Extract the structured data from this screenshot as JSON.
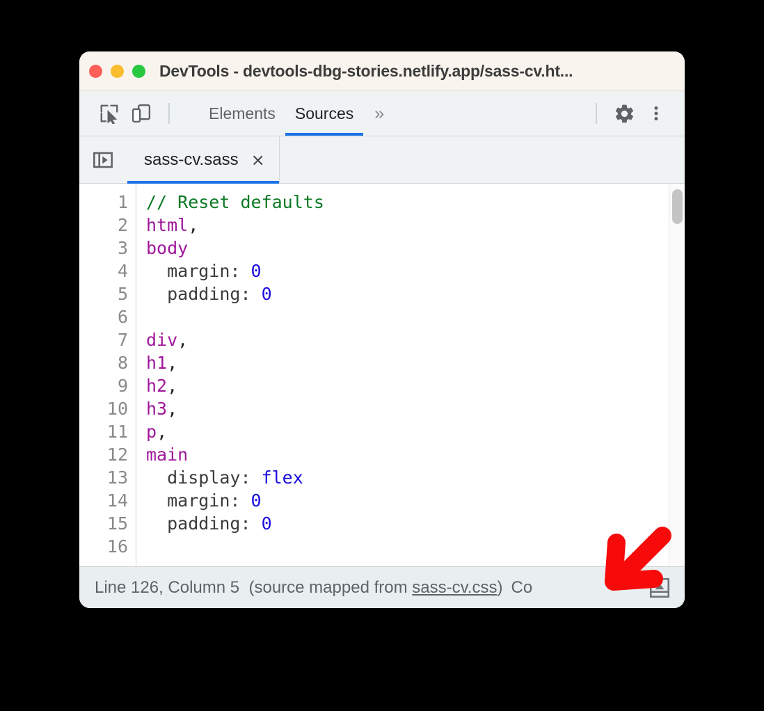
{
  "window": {
    "title": "DevTools - devtools-dbg-stories.netlify.app/sass-cv.ht...",
    "traffic_lights": [
      {
        "name": "close",
        "color": "#ff5f57"
      },
      {
        "name": "minimize",
        "color": "#f9bd2e"
      },
      {
        "name": "maximize",
        "color": "#28c840"
      }
    ]
  },
  "toolbar": {
    "inspect_icon": "inspect-element-icon",
    "device_icon": "device-toolbar-icon",
    "panels": [
      {
        "label": "Elements",
        "active": false
      },
      {
        "label": "Sources",
        "active": true
      }
    ],
    "more_panels_label": "»",
    "settings_icon": "gear-icon",
    "menu_icon": "kebab-menu-icon",
    "accent_color": "#1a73e8"
  },
  "file_tabs": {
    "navigator_toggle_icon": "show-navigator-icon",
    "tabs": [
      {
        "label": "sass-cv.sass",
        "close_label": "×",
        "active": true
      }
    ]
  },
  "editor": {
    "language": "sass",
    "first_visible_line": 1,
    "lines": [
      {
        "number": "1",
        "tokens": [
          {
            "t": "// Reset defaults",
            "c": "tok-comment"
          }
        ]
      },
      {
        "number": "2",
        "tokens": [
          {
            "t": "html",
            "c": "tok-selector"
          },
          {
            "t": ",",
            "c": "tok-punct"
          }
        ]
      },
      {
        "number": "3",
        "tokens": [
          {
            "t": "body",
            "c": "tok-selector"
          }
        ]
      },
      {
        "number": "4",
        "tokens": [
          {
            "t": "  margin: ",
            "c": "tok-prop"
          },
          {
            "t": "0",
            "c": "tok-value"
          }
        ]
      },
      {
        "number": "5",
        "tokens": [
          {
            "t": "  padding: ",
            "c": "tok-prop"
          },
          {
            "t": "0",
            "c": "tok-value"
          }
        ]
      },
      {
        "number": "6",
        "tokens": [
          {
            "t": "",
            "c": "tok-punct"
          }
        ]
      },
      {
        "number": "7",
        "tokens": [
          {
            "t": "div",
            "c": "tok-selector"
          },
          {
            "t": ",",
            "c": "tok-punct"
          }
        ]
      },
      {
        "number": "8",
        "tokens": [
          {
            "t": "h1",
            "c": "tok-selector"
          },
          {
            "t": ",",
            "c": "tok-punct"
          }
        ]
      },
      {
        "number": "9",
        "tokens": [
          {
            "t": "h2",
            "c": "tok-selector"
          },
          {
            "t": ",",
            "c": "tok-punct"
          }
        ]
      },
      {
        "number": "10",
        "tokens": [
          {
            "t": "h3",
            "c": "tok-selector"
          },
          {
            "t": ",",
            "c": "tok-punct"
          }
        ]
      },
      {
        "number": "11",
        "tokens": [
          {
            "t": "p",
            "c": "tok-selector"
          },
          {
            "t": ",",
            "c": "tok-punct"
          }
        ]
      },
      {
        "number": "12",
        "tokens": [
          {
            "t": "main",
            "c": "tok-selector"
          }
        ]
      },
      {
        "number": "13",
        "tokens": [
          {
            "t": "  display: ",
            "c": "tok-prop"
          },
          {
            "t": "flex",
            "c": "tok-value"
          }
        ]
      },
      {
        "number": "14",
        "tokens": [
          {
            "t": "  margin: ",
            "c": "tok-prop"
          },
          {
            "t": "0",
            "c": "tok-value"
          }
        ]
      },
      {
        "number": "15",
        "tokens": [
          {
            "t": "  padding: ",
            "c": "tok-prop"
          },
          {
            "t": "0",
            "c": "tok-value"
          }
        ]
      },
      {
        "number": "16",
        "tokens": [
          {
            "t": "",
            "c": "tok-punct"
          }
        ]
      }
    ],
    "syntax_colors": {
      "comment": "#0a7a24",
      "selector": "#a0179b",
      "property": "#3c3c3c",
      "value": "#1a0dde"
    }
  },
  "status_bar": {
    "line_label": "Line 126, Column 5",
    "source_prefix": "(source mapped from ",
    "source_link": "sass-cv.css",
    "source_suffix": ")",
    "trailing_text": "Co",
    "drawer_icon": "show-drawer-icon"
  },
  "annotation": {
    "arrow_color": "#f60a0a",
    "arrow_direction": "down-left"
  }
}
